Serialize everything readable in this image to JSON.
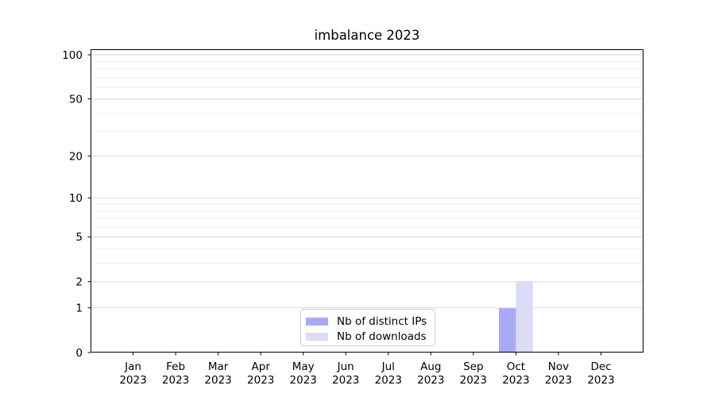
{
  "figure": {
    "background": "#ffffff"
  },
  "chart_data": {
    "type": "bar",
    "title": "imbalance 2023",
    "categories": [
      "Jan 2023",
      "Feb 2023",
      "Mar 2023",
      "Apr 2023",
      "May 2023",
      "Jun 2023",
      "Jul 2023",
      "Aug 2023",
      "Sep 2023",
      "Oct 2023",
      "Nov 2023",
      "Dec 2023"
    ],
    "x_tick_months": [
      "Jan",
      "Feb",
      "Mar",
      "Apr",
      "May",
      "Jun",
      "Jul",
      "Aug",
      "Sep",
      "Oct",
      "Nov",
      "Dec"
    ],
    "x_tick_year": "2023",
    "series": [
      {
        "name": "Nb of distinct IPs",
        "color": "#a9a9f6",
        "values": [
          0,
          0,
          0,
          0,
          0,
          0,
          0,
          0,
          0,
          1,
          0,
          0
        ]
      },
      {
        "name": "Nb of downloads",
        "color": "#dcdcf6",
        "values": [
          0,
          0,
          0,
          0,
          0,
          0,
          0,
          0,
          0,
          2,
          0,
          0
        ]
      }
    ],
    "xlabel": "",
    "ylabel": "",
    "yscale": "log1p",
    "yticks": [
      0,
      1,
      2,
      5,
      10,
      20,
      50,
      100
    ],
    "minor_yticks": [
      3,
      4,
      6,
      7,
      8,
      9,
      30,
      40,
      60,
      70,
      80,
      90
    ],
    "ylim": [
      0,
      110
    ],
    "grid": true,
    "legend_position": "lower center",
    "colors": {
      "major_grid": "#d9d9d9",
      "minor_grid": "#ededed",
      "spine": "#000000",
      "tick_text": "#000000",
      "legend_border": "#cccccc"
    }
  }
}
